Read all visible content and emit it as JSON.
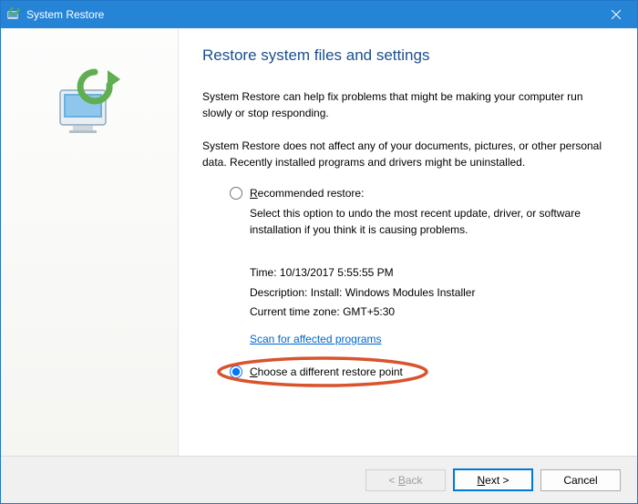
{
  "window": {
    "title": "System Restore"
  },
  "heading": "Restore system files and settings",
  "paragraph1": "System Restore can help fix problems that might be making your computer run slowly or stop responding.",
  "paragraph2": "System Restore does not affect any of your documents, pictures, or other personal data. Recently installed programs and drivers might be uninstalled.",
  "option_recommended": {
    "label_prefix": "R",
    "label_rest": "ecommended restore:",
    "description": "Select this option to undo the most recent update, driver, or software installation if you think it is causing problems."
  },
  "details": {
    "time_label": "Time:",
    "time_value": "10/13/2017 5:55:55 PM",
    "desc_label": "Description:",
    "desc_value": "Install: Windows Modules Installer",
    "tz_label": "Current time zone:",
    "tz_value": "GMT+5:30"
  },
  "scan_link": "Scan for affected programs",
  "option_choose": {
    "label_prefix": "C",
    "label_rest": "hoose a different restore point"
  },
  "buttons": {
    "back_prefix": "< ",
    "back_u": "B",
    "back_rest": "ack",
    "next_u": "N",
    "next_rest": "ext >",
    "cancel": "Cancel"
  }
}
